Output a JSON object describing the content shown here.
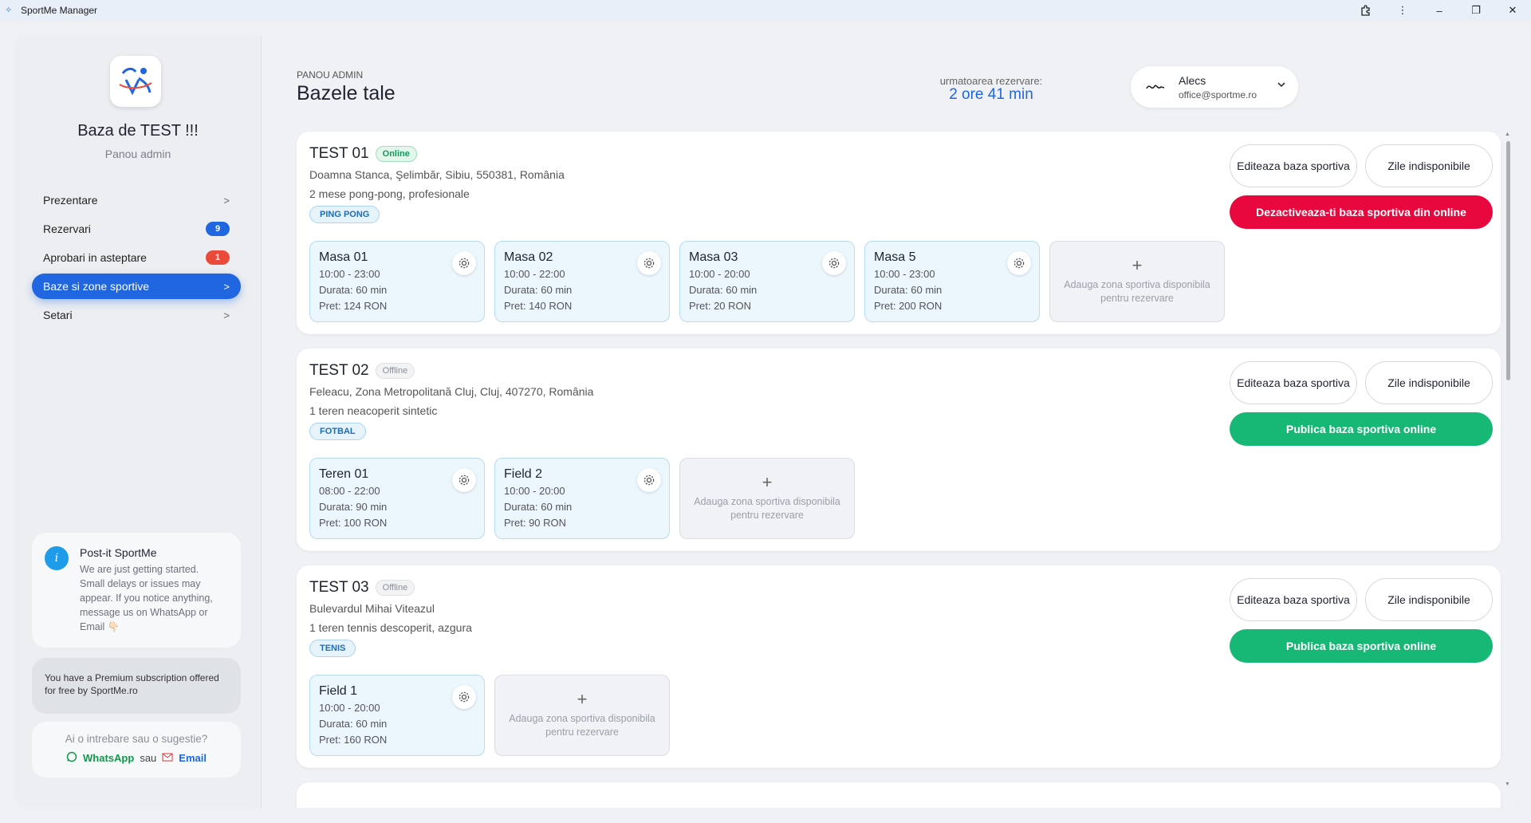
{
  "window": {
    "title": "SportMe Manager"
  },
  "sidebar": {
    "base_title": "Baza de TEST !!!",
    "base_subtitle": "Panou admin",
    "nav": [
      {
        "label": "Prezentare",
        "chevron": ">"
      },
      {
        "label": "Rezervari",
        "badge": "9",
        "badge_color": "#1f66e0"
      },
      {
        "label": "Aprobari in asteptare",
        "badge": "1",
        "badge_color": "#e94a3a"
      },
      {
        "label": "Baze si zone sportive",
        "chevron": ">",
        "active": true
      },
      {
        "label": "Setari",
        "chevron": ">"
      }
    ],
    "postit": {
      "title": "Post-it SportMe",
      "body": "We are just getting started. Small delays or issues may appear. If you notice anything, message us on WhatsApp or Email 👇🏻"
    },
    "premium_text": "You have a Premium subscription offered for free by SportMe.ro",
    "question": {
      "text": "Ai o intrebare sau o sugestie?",
      "whatsapp": "WhatsApp",
      "sep": "sau",
      "email": "Email"
    }
  },
  "header": {
    "eyebrow": "PANOU ADMIN",
    "title": "Bazele tale",
    "next_label": "urmatoarea rezervare:",
    "next_value": "2 ore 41 min",
    "user": {
      "name": "Alecs",
      "email": "office@sportme.ro"
    }
  },
  "bases": [
    {
      "name": "TEST 01",
      "status": "Online",
      "address": "Doamna Stanca, Şelimbăr, Sibiu, 550381, România",
      "description": "2 mese pong-pong, profesionale",
      "tag": "PING PONG",
      "edit_label": "Editeaza baza sportiva",
      "days_label": "Zile indisponibile",
      "action_label": "Dezactiveaza-ti baza sportiva din online",
      "zones": [
        {
          "name": "Masa 01",
          "hours": "10:00 - 23:00",
          "duration": "Durata: 60 min",
          "price": "Pret: 124 RON"
        },
        {
          "name": "Masa 02",
          "hours": "10:00 - 22:00",
          "duration": "Durata: 60 min",
          "price": "Pret: 140 RON"
        },
        {
          "name": "Masa 03",
          "hours": "10:00 - 20:00",
          "duration": "Durata: 60 min",
          "price": "Pret: 20 RON"
        },
        {
          "name": "Masa 5",
          "hours": "10:00 - 23:00",
          "duration": "Durata: 60 min",
          "price": "Pret: 200 RON"
        }
      ],
      "add_label": "Adauga zona sportiva disponibila pentru rezervare"
    },
    {
      "name": "TEST 02",
      "status": "Offline",
      "address": "Feleacu, Zona Metropolitană Cluj, Cluj, 407270, România",
      "description": "1 teren neacoperit sintetic",
      "tag": "FOTBAL",
      "edit_label": "Editeaza baza sportiva",
      "days_label": "Zile indisponibile",
      "action_label": "Publica baza sportiva online",
      "zones": [
        {
          "name": "Teren 01",
          "hours": "08:00 - 22:00",
          "duration": "Durata: 90 min",
          "price": "Pret: 100 RON"
        },
        {
          "name": "Field 2",
          "hours": "10:00 - 20:00",
          "duration": "Durata: 60 min",
          "price": "Pret: 90 RON"
        }
      ],
      "add_label": "Adauga zona sportiva disponibila pentru rezervare"
    },
    {
      "name": "TEST 03",
      "status": "Offline",
      "address": "Bulevardul Mihai Viteazul",
      "description": "1 teren tennis descoperit, azgura",
      "tag": "TENIS",
      "edit_label": "Editeaza baza sportiva",
      "days_label": "Zile indisponibile",
      "action_label": "Publica baza sportiva online",
      "zones": [
        {
          "name": "Field 1",
          "hours": "10:00 - 20:00",
          "duration": "Durata: 60 min",
          "price": "Pret: 160 RON"
        }
      ],
      "add_label": "Adauga zona sportiva disponibila pentru rezervare"
    }
  ],
  "icons": {
    "gear": "gear-icon",
    "plus": "+",
    "info": "i",
    "chevron_down": "chevron-down-icon",
    "whatsapp": "whatsapp-icon",
    "email": "email-icon",
    "logo": "sportme-logo"
  },
  "colors": {
    "accent": "#1f66e0",
    "danger": "#e8083e",
    "success": "#17b775"
  }
}
